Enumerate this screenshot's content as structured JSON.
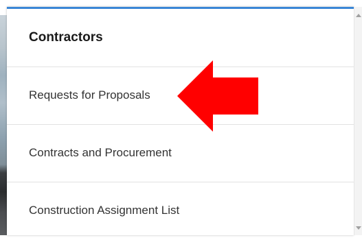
{
  "menu": {
    "header": "Contractors",
    "items": [
      {
        "label": "Requests for Proposals"
      },
      {
        "label": "Contracts and Procurement"
      },
      {
        "label": "Construction Assignment List"
      }
    ]
  },
  "annotation": {
    "arrow_color": "#ff0000",
    "arrow_icon": "left-arrow-icon"
  },
  "colors": {
    "accent": "#3a86d6"
  }
}
